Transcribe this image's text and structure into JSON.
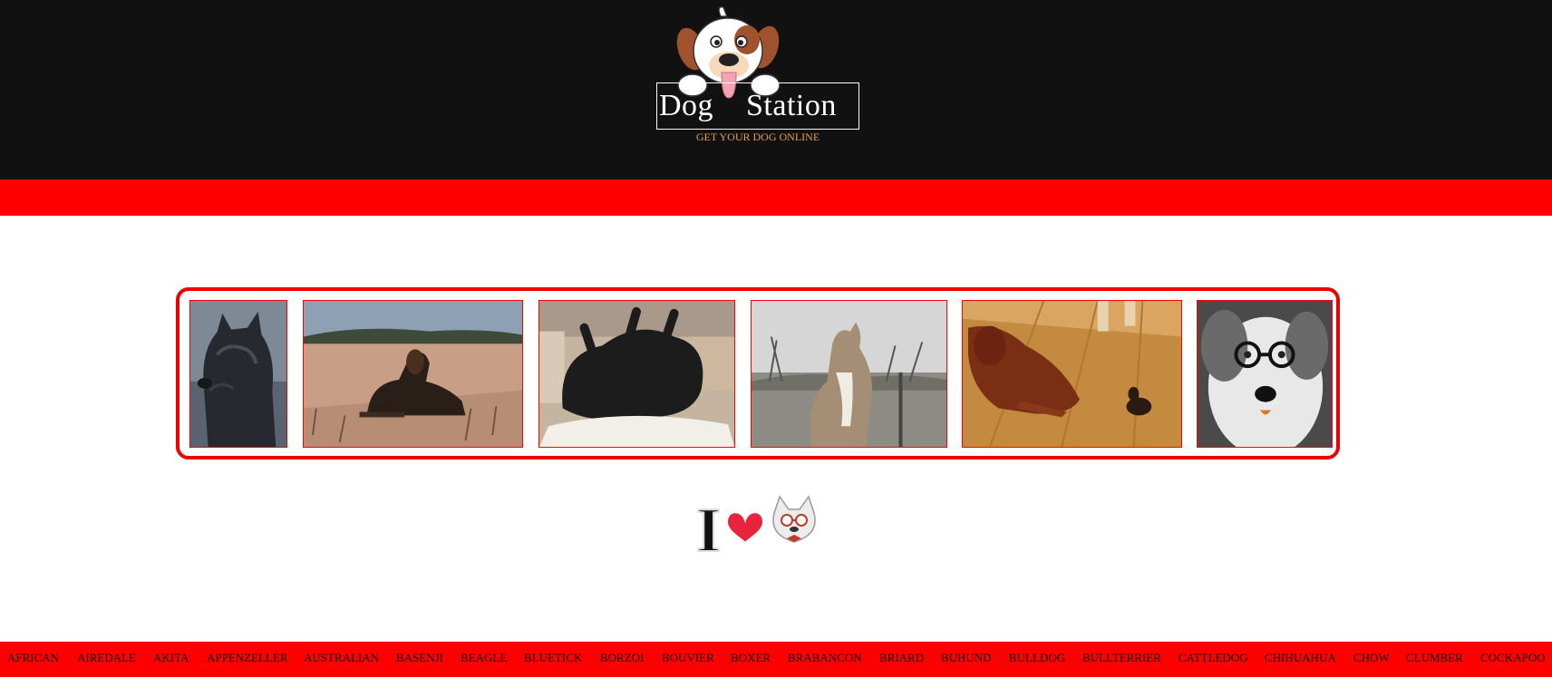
{
  "brand": {
    "word1": "Dog",
    "word2": "Station",
    "tagline": "GET YOUR DOG ONLINE"
  },
  "colors": {
    "header_bg": "#111111",
    "accent": "#ff0000",
    "tagline": "#e89b4a"
  },
  "gallery": {
    "photos": [
      {
        "alt": "black shaggy terrier"
      },
      {
        "alt": "wire-haired dachshund on grass"
      },
      {
        "alt": "black dog sleeping on couch"
      },
      {
        "alt": "sheltie sitting outdoors"
      },
      {
        "alt": "red setter lying on wood floor"
      },
      {
        "alt": "sheepdog wearing glasses"
      }
    ]
  },
  "love_badge": {
    "letter": "I"
  },
  "breeds": [
    "AFRICAN",
    "AIREDALE",
    "AKITA",
    "APPENZELLER",
    "AUSTRALIAN",
    "BASENJI",
    "BEAGLE",
    "BLUETICK",
    "BORZOI",
    "BOUVIER",
    "BOXER",
    "BRABANCON",
    "BRIARD",
    "BUHUND",
    "BULLDOG",
    "BULLTERRIER",
    "CATTLEDOG",
    "CHIHUAHUA",
    "CHOW",
    "CLUMBER",
    "COCKAPOO"
  ]
}
